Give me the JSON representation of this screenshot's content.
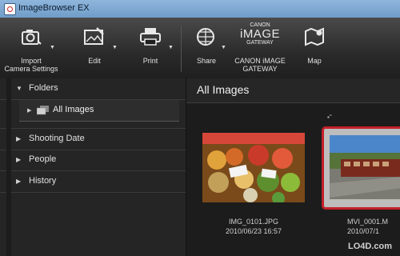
{
  "window": {
    "title": "ImageBrowser EX"
  },
  "toolbar": {
    "import": {
      "label_line1": "Import",
      "label_line2": "Camera Settings"
    },
    "edit": {
      "label": "Edit"
    },
    "print": {
      "label": "Print"
    },
    "share": {
      "label": "Share"
    },
    "canon_logo": {
      "line1": "CANON",
      "line2": "iMAGE",
      "line3": "GATEWAY"
    },
    "canon_gateway": {
      "label_line1": "CANON iMAGE",
      "label_line2": "GATEWAY"
    },
    "map": {
      "label": "Map"
    }
  },
  "sidebar": {
    "folders": "Folders",
    "all_images": "All Images",
    "shooting_date": "Shooting Date",
    "people": "People",
    "history": "History"
  },
  "main": {
    "title": "All Images",
    "items": [
      {
        "name": "IMG_0101.JPG",
        "date": "2010/06/23 16:57"
      },
      {
        "name": "MVI_0001.M",
        "date": "2010/07/1"
      }
    ]
  },
  "watermark": "LO4D.com"
}
